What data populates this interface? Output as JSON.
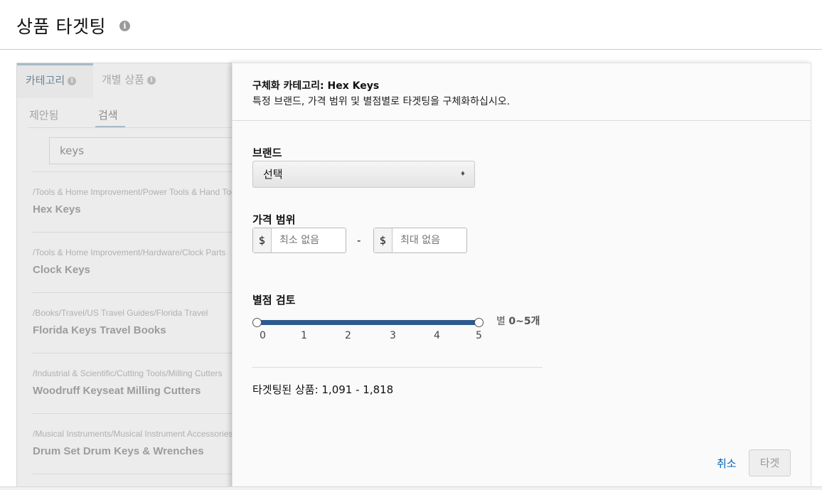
{
  "header": {
    "title": "상품 타겟팅",
    "info_icon": "info-icon"
  },
  "left_panel": {
    "tabs": [
      {
        "label": "카테고리",
        "active": true
      },
      {
        "label": "개별 상품",
        "active": false
      }
    ],
    "subtabs": [
      {
        "label": "제안됨",
        "active": false
      },
      {
        "label": "검색",
        "active": true
      }
    ],
    "search": {
      "value": "keys"
    },
    "results": [
      {
        "path": "/Tools & Home Improvement/Power Tools & Hand Tools/Hand Tools",
        "name": "Hex Keys"
      },
      {
        "path": "/Tools & Home Improvement/Hardware/Clock Parts",
        "name": "Clock Keys"
      },
      {
        "path": "/Books/Travel/US Travel Guides/Florida Travel",
        "name": "Florida Keys Travel Books"
      },
      {
        "path": "/Industrial & Scientific/Cutting Tools/Milling Cutters",
        "name": "Woodruff Keyseat Milling Cutters"
      },
      {
        "path": "/Musical Instruments/Musical Instrument Accessories",
        "name": "Drum Set Drum Keys & Wrenches"
      }
    ]
  },
  "refine": {
    "title": "구체화 카테고리: Hex Keys",
    "description": "특정 브랜드, 가격 범위 및 별점별로 타겟팅을 구체화하십시오.",
    "brand": {
      "label": "브랜드",
      "selected": "선택"
    },
    "price": {
      "label": "가격 범위",
      "currency": "$",
      "min_placeholder": "최소 없음",
      "max_placeholder": "최대 없음",
      "separator": "-"
    },
    "rating": {
      "label": "별점 검토",
      "min": 0,
      "max": 5,
      "ticks": [
        "0",
        "1",
        "2",
        "3",
        "4",
        "5"
      ],
      "readout_prefix": "별",
      "readout_value": "0~5개"
    },
    "targeted_count": "타겟팅된 상품: 1,091 - 1,818",
    "cancel_label": "취소",
    "target_label": "타겟"
  },
  "colors": {
    "slider_fill": "#2d5a8c",
    "link": "#0066c0"
  }
}
